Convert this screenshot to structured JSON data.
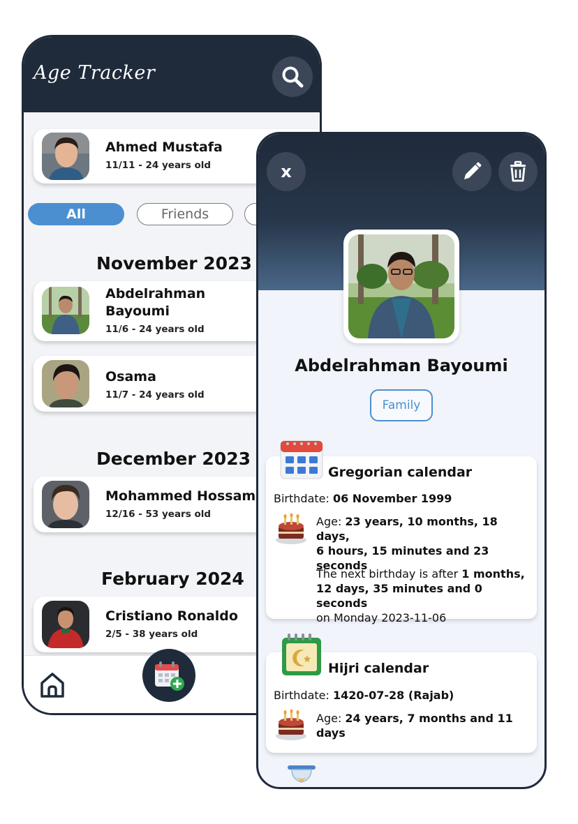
{
  "back": {
    "app_title": "Age Tracker",
    "top_card": {
      "name": "Ahmed Mustafa",
      "subtitle": "11/11 - 24 years old"
    },
    "filters": [
      "All",
      "Friends"
    ],
    "sections": [
      {
        "month": "November 2023",
        "entries": [
          {
            "name_line1": "Abdelrahman",
            "name_line2": "Bayoumi",
            "subtitle": "11/6 - 24 years old"
          },
          {
            "name": "Osama",
            "subtitle": "11/7 - 24 years old"
          }
        ]
      },
      {
        "month": "December 2023",
        "entries": [
          {
            "name": "Mohammed Hossam",
            "subtitle": "12/16 - 53 years old"
          }
        ]
      },
      {
        "month": "February 2024",
        "entries": [
          {
            "name": "Cristiano Ronaldo",
            "subtitle": "2/5 - 38 years old"
          }
        ]
      }
    ],
    "icons": {
      "search": "search-icon",
      "home": "home-icon",
      "add": "calendar-add-icon"
    }
  },
  "detail": {
    "close_label": "x",
    "name": "Abdelrahman Bayoumi",
    "tag": "Family",
    "gregorian": {
      "title": "Gregorian calendar",
      "birthdate_label": "Birthdate: ",
      "birthdate": "06 November 1999",
      "age_label": "Age: ",
      "age_line1": "23 years, 10 months, 18 days,",
      "age_line2": "6 hours, 15 minutes and 23",
      "age_line3": "seconds",
      "next_prefix": "The next birthday is after ",
      "next_line1": "1 months,",
      "next_line2": "12 days, 35 minutes and 0 seconds",
      "next_line3": "on Monday 2023-11-06"
    },
    "hijri": {
      "title": "Hijri calendar",
      "birthdate_label": "Birthdate: ",
      "birthdate": "1420-07-28 (Rajab)",
      "age_label": "Age: ",
      "age": "24 years, 7 months and 11 days"
    },
    "icons": {
      "edit": "pencil-icon",
      "delete": "trash-icon",
      "calendar": "calendar-icon",
      "hijri": "crescent-calendar-icon",
      "cake": "cake-icon",
      "hourglass": "hourglass-icon"
    },
    "colors": {
      "header": "#1f2a3a",
      "accent": "#4b8fd1"
    }
  }
}
